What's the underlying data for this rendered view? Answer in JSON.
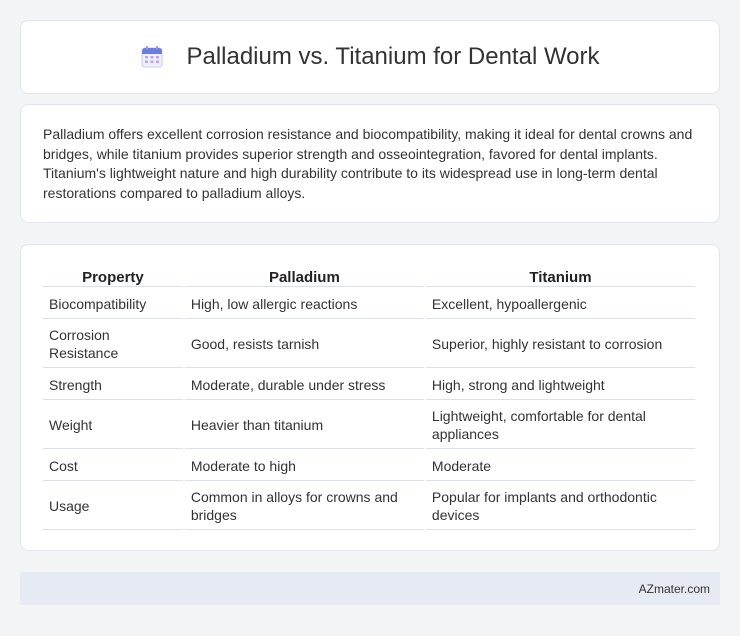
{
  "header": {
    "title": "Palladium vs. Titanium for Dental Work",
    "icon": "calendar-icon"
  },
  "summary": {
    "text": "Palladium offers excellent corrosion resistance and biocompatibility, making it ideal for dental crowns and bridges, while titanium provides superior strength and osseointegration, favored for dental implants. Titanium's lightweight nature and high durability contribute to its widespread use in long-term dental restorations compared to palladium alloys."
  },
  "table": {
    "headers": [
      "Property",
      "Palladium",
      "Titanium"
    ],
    "rows": [
      [
        "Biocompatibility",
        "High, low allergic reactions",
        "Excellent, hypoallergenic"
      ],
      [
        "Corrosion Resistance",
        "Good, resists tarnish",
        "Superior, highly resistant to corrosion"
      ],
      [
        "Strength",
        "Moderate, durable under stress",
        "High, strong and lightweight"
      ],
      [
        "Weight",
        "Heavier than titanium",
        "Lightweight, comfortable for dental appliances"
      ],
      [
        "Cost",
        "Moderate to high",
        "Moderate"
      ],
      [
        "Usage",
        "Common in alloys for crowns and bridges",
        "Popular for implants and orthodontic devices"
      ]
    ]
  },
  "footer": {
    "text": "AZmater.com"
  },
  "colors": {
    "background": "#f3f4f6",
    "card": "#ffffff",
    "footer_bg": "#e6ebf3",
    "icon_accent": "#6a7de0"
  }
}
